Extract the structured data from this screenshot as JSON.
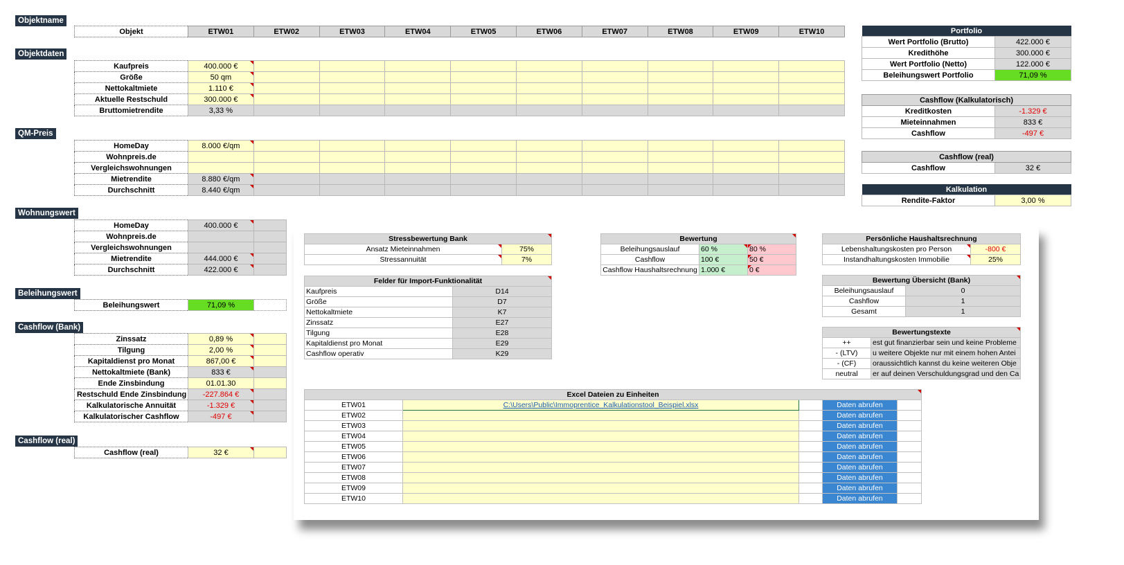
{
  "sections": {
    "objektname": "Objektname",
    "objektdaten": "Objektdaten",
    "qm_preis": "QM-Preis",
    "wohnungswert": "Wohnungswert",
    "beleihungswert": "Beleihungswert",
    "cashflow_bank": "Cashflow (Bank)",
    "cashflow_real": "Cashflow (real)"
  },
  "header": {
    "objekt_label": "Objekt",
    "units": [
      "ETW01",
      "ETW02",
      "ETW03",
      "ETW04",
      "ETW05",
      "ETW06",
      "ETW07",
      "ETW08",
      "ETW09",
      "ETW10"
    ]
  },
  "objektdaten": [
    {
      "label": "Kaufpreis",
      "value": "400.000 €"
    },
    {
      "label": "Größe",
      "value": "50 qm"
    },
    {
      "label": "Nettokaltmiete",
      "value": "1.110 €"
    },
    {
      "label": "Aktuelle Restschuld",
      "value": "300.000 €"
    },
    {
      "label": "Bruttomietrendite",
      "value": "3,33 %"
    }
  ],
  "qm_preis": [
    {
      "label": "HomeDay",
      "value": "8.000 €/qm"
    },
    {
      "label": "Wohnpreis.de",
      "value": ""
    },
    {
      "label": "Vergleichswohnungen",
      "value": ""
    },
    {
      "label": "Mietrendite",
      "value": "8.880 €/qm"
    },
    {
      "label": "Durchschnitt",
      "value": "8.440 €/qm"
    }
  ],
  "wohnungswert": [
    {
      "label": "HomeDay",
      "value": "400.000 €"
    },
    {
      "label": "Wohnpreis.de",
      "value": ""
    },
    {
      "label": "Vergleichswohnungen",
      "value": ""
    },
    {
      "label": "Mietrendite",
      "value": "444.000 €"
    },
    {
      "label": "Durchschnitt",
      "value": "422.000 €"
    }
  ],
  "beleihungswert": {
    "label": "Beleihungswert",
    "value": "71,09 %"
  },
  "cashflow_bank": [
    {
      "label": "Zinssatz",
      "value": "0,89 %"
    },
    {
      "label": "Tilgung",
      "value": "2,00 %"
    },
    {
      "label": "Kapitaldienst pro Monat",
      "value": "867,00 €"
    },
    {
      "label": "Nettokaltmiete (Bank)",
      "value": "833 €"
    },
    {
      "label": "Ende Zinsbindung",
      "value": "01.01.30"
    },
    {
      "label": "Restschuld Ende Zinsbindung",
      "value": "-227.864 €"
    },
    {
      "label": "Kalkulatorische Annuität",
      "value": "-1.329 €"
    },
    {
      "label": "Kalkulatorischer Cashflow",
      "value": "-497 €"
    }
  ],
  "cashflow_real": {
    "label": "Cashflow (real)",
    "value": "32 €"
  },
  "portfolio": {
    "title": "Portfolio",
    "rows": [
      {
        "label": "Wert Portfolio (Brutto)",
        "value": "422.000 €"
      },
      {
        "label": "Kredithöhe",
        "value": "300.000 €"
      },
      {
        "label": "Wert Portfolio (Netto)",
        "value": "122.000 €"
      },
      {
        "label": "Beleihungswert Portfolio",
        "value": "71,09 %"
      }
    ]
  },
  "cashflow_kalk": {
    "title": "Cashflow (Kalkulatorisch)",
    "rows": [
      {
        "label": "Kreditkosten",
        "value": "-1.329 €"
      },
      {
        "label": "Mieteinnahmen",
        "value": "833 €"
      },
      {
        "label": "Cashflow",
        "value": "-497 €"
      }
    ]
  },
  "cashflow_real_panel": {
    "title": "Cashflow (real)",
    "label": "Cashflow",
    "value": "32 €"
  },
  "kalkulation": {
    "title": "Kalkulation",
    "label": "Rendite-Faktor",
    "value": "3,00 %"
  },
  "stress": {
    "title": "Stressbewertung Bank",
    "rows": [
      {
        "label": "Ansatz Mieteinnahmen",
        "value": "75%"
      },
      {
        "label": "Stressannuität",
        "value": "7%"
      }
    ]
  },
  "bewertung": {
    "title": "Bewertung",
    "rows": [
      {
        "label": "Beleihungsauslauf",
        "good": "60 %",
        "bad": "80 %"
      },
      {
        "label": "Cashflow",
        "good": "100 €",
        "bad": "50 €"
      },
      {
        "label": "Cashflow Haushaltsrechnung",
        "good": "1.000 €",
        "bad": "0 €"
      }
    ]
  },
  "haushalt": {
    "title": "Persönliche Haushaltsrechnung",
    "rows": [
      {
        "label": "Lebenshaltungskosten pro Person",
        "value": "-800 €"
      },
      {
        "label": "Instandhaltungskosten Immobilie",
        "value": "25%"
      }
    ]
  },
  "import": {
    "title": "Felder für Import-Funktionalität",
    "rows": [
      {
        "label": "Kaufpreis",
        "value": "D14"
      },
      {
        "label": "Größe",
        "value": "D7"
      },
      {
        "label": "Nettokaltmiete",
        "value": "K7"
      },
      {
        "label": "Zinssatz",
        "value": "E27"
      },
      {
        "label": "Tilgung",
        "value": "E28"
      },
      {
        "label": "Kapitaldienst pro Monat",
        "value": "E29"
      },
      {
        "label": "Cashflow operativ",
        "value": "K29"
      }
    ]
  },
  "bewertung_uebersicht": {
    "title": "Bewertung Übersicht (Bank)",
    "rows": [
      {
        "label": "Beleihungsauslauf",
        "value": "0"
      },
      {
        "label": "Cashflow",
        "value": "1"
      },
      {
        "label": "Gesamt",
        "value": "1"
      }
    ]
  },
  "bewertungstexte": {
    "title": "Bewertungstexte",
    "rows": [
      {
        "label": "++",
        "text": "est gut finanzierbar sein und keine Probleme"
      },
      {
        "label": "- (LTV)",
        "text": "u weitere Objekte nur mit einem hohen Antei"
      },
      {
        "label": "- (CF)",
        "text": "oraussichtlich kannst du keine weiteren Obje"
      },
      {
        "label": "neutral",
        "text": "er auf deinen Verschuldungsgrad und den Ca"
      }
    ]
  },
  "excel": {
    "title": "Excel Dateien zu Einheiten",
    "button_label": "Daten abrufen",
    "rows": [
      {
        "unit": "ETW01",
        "path": "C:\\Users\\Public\\Immoprentice_Kalkulationstool_Beispiel.xlsx"
      },
      {
        "unit": "ETW02",
        "path": ""
      },
      {
        "unit": "ETW03",
        "path": ""
      },
      {
        "unit": "ETW04",
        "path": ""
      },
      {
        "unit": "ETW05",
        "path": ""
      },
      {
        "unit": "ETW06",
        "path": ""
      },
      {
        "unit": "ETW07",
        "path": ""
      },
      {
        "unit": "ETW08",
        "path": ""
      },
      {
        "unit": "ETW09",
        "path": ""
      },
      {
        "unit": "ETW10",
        "path": ""
      }
    ]
  },
  "colors": {
    "navy": "#253545",
    "yellow": "#ffffcc",
    "grey": "#d9d9d9",
    "green": "#66dd22",
    "red": "#e00000",
    "button": "#3a86d0"
  }
}
